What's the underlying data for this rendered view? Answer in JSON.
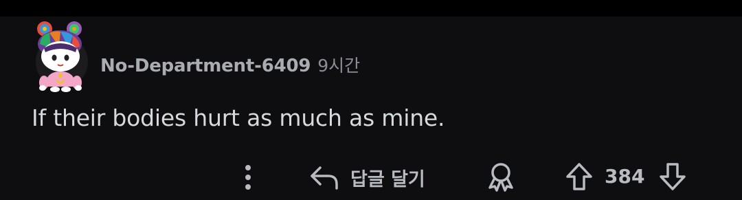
{
  "comment": {
    "username": "No-Department-6409",
    "timestamp": "9시간",
    "body": "If their bodies hurt as much as mine.",
    "avatar_icon": "snoo-avatar-rainbow-hair"
  },
  "actions": {
    "more_icon": "more-vertical-icon",
    "reply_icon": "reply-arrow-icon",
    "reply_label": "답글 달기",
    "award_icon": "award-icon",
    "upvote_icon": "upvote-arrow-icon",
    "score": "384",
    "downvote_icon": "downvote-arrow-icon"
  },
  "colors": {
    "background": "#0e0e10",
    "top_bar": "#000000",
    "text_primary": "#d7dadc",
    "text_meta": "#a9adb1",
    "icon": "#b8bcc0"
  }
}
